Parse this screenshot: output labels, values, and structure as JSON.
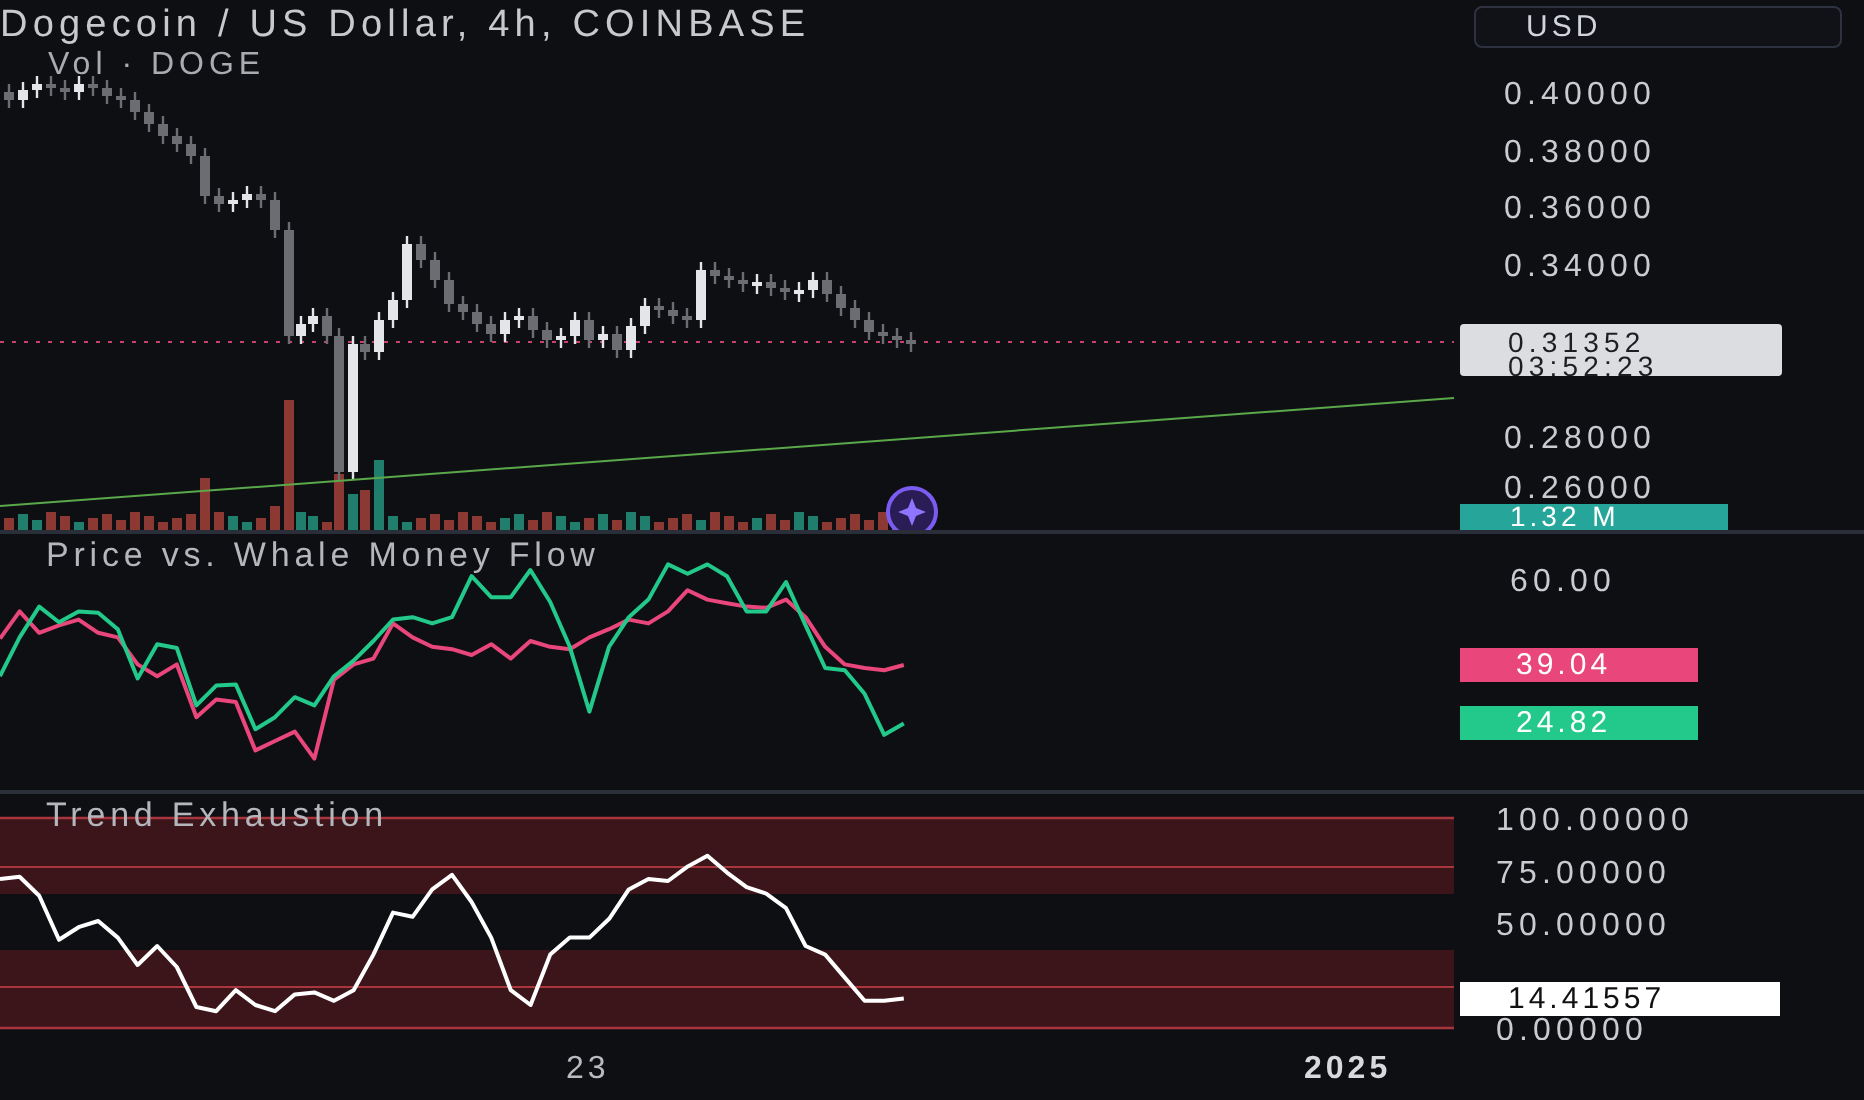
{
  "chart_header": {
    "title": "Dogecoin / US Dollar, 4h, COINBASE",
    "volume_legend": "Vol · DOGE"
  },
  "currency_button": {
    "label": "USD"
  },
  "price_axis": {
    "labels": [
      "0.40000",
      "0.38000",
      "0.36000",
      "0.34000",
      "0.28000",
      "0.26000"
    ]
  },
  "last_price_label": {
    "price": "0.31352",
    "countdown": "03:52:23"
  },
  "volume_label": "1.32 M",
  "whale_flow_pane": {
    "title": "Price vs. Whale Money Flow",
    "axis_label": "60.00",
    "value_labels": [
      {
        "text": "39.04",
        "color": "#e9467b"
      },
      {
        "text": "24.82",
        "color": "#22c98a"
      }
    ]
  },
  "trend_pane": {
    "title": "Trend Exhaustion",
    "value_label": "14.41557",
    "chart_data": {
      "type": "line",
      "ylim": [
        0,
        100
      ],
      "categories": [
        null,
        null,
        null,
        null,
        null,
        null,
        null,
        null,
        null,
        null,
        null,
        null,
        null,
        null,
        null,
        null,
        null,
        null,
        null,
        null,
        null,
        null,
        null,
        null,
        null,
        null,
        null,
        null,
        null,
        null,
        null,
        null,
        null,
        null,
        null,
        null,
        null,
        null,
        null,
        null,
        null,
        null,
        null,
        null,
        null,
        null,
        null,
        null,
        null,
        null,
        null,
        null,
        null,
        null,
        null,
        null,
        null,
        null,
        null,
        null,
        null,
        null,
        null,
        null,
        null,
        null,
        null,
        null,
        null,
        null,
        null,
        null,
        null,
        null,
        null
      ],
      "yticks": [
        {
          "value": 100,
          "label": "100.00000"
        },
        {
          "value": 75,
          "label": "75.00000"
        },
        {
          "value": 50,
          "label": "50.00000"
        },
        {
          "value": 0,
          "label": "0.00000"
        }
      ],
      "series": [
        {
          "color": "#ffffff",
          "values": [
            71,
            72,
            63,
            42,
            48,
            51,
            43,
            30,
            39,
            29,
            10,
            8,
            18,
            11,
            8,
            16,
            17,
            13,
            18,
            35,
            55,
            53,
            66,
            73,
            60,
            43,
            18,
            11,
            35,
            43,
            43,
            52,
            66,
            71,
            70,
            77,
            82,
            74,
            67,
            64,
            57,
            39,
            35,
            24,
            13,
            13,
            14,
            null,
            null,
            null,
            null,
            null,
            null,
            null,
            null,
            null,
            null,
            null,
            null,
            null,
            null,
            null,
            null,
            null,
            null,
            null,
            null,
            null,
            null,
            null,
            null,
            null,
            null,
            null,
            null
          ]
        }
      ]
    }
  },
  "time_axis": {
    "labels": [
      "23",
      "2025"
    ]
  }
}
